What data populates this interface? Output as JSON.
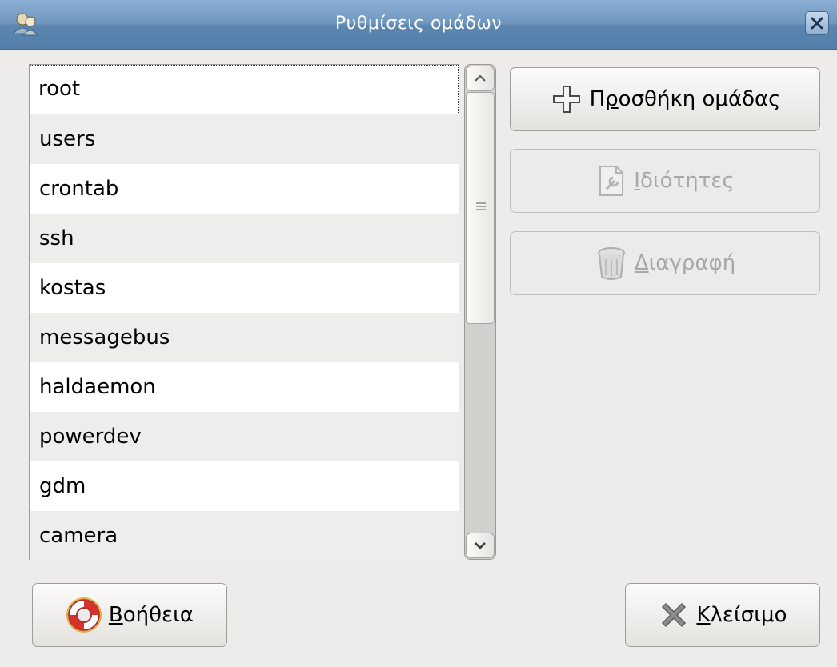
{
  "window": {
    "title": "Ρυθμίσεις ομάδων"
  },
  "groups": [
    "root",
    "users",
    "crontab",
    "ssh",
    "kostas",
    "messagebus",
    "haldaemon",
    "powerdev",
    "gdm",
    "camera"
  ],
  "buttons": {
    "add_group": {
      "mnemonic": "",
      "prefix": "Π",
      "accel": "ρ",
      "rest": "οσθήκη ομάδας",
      "icon": "plus-icon",
      "enabled": true
    },
    "properties": {
      "prefix": "",
      "accel": "Ι",
      "rest": "διότητες",
      "icon": "properties-icon",
      "enabled": false
    },
    "delete": {
      "prefix": "",
      "accel": "Δ",
      "rest": "ιαγραφή",
      "icon": "trash-icon",
      "enabled": false
    },
    "help": {
      "prefix": "",
      "accel": "Β",
      "rest": "οήθεια",
      "icon": "lifebuoy-icon",
      "enabled": true
    },
    "close": {
      "prefix": "",
      "accel": "Κ",
      "rest": "λείσιμο",
      "icon": "close-x-icon",
      "enabled": true
    }
  },
  "colors": {
    "titlebar": "#6f96bd",
    "window_bg": "#edeceb",
    "row_alt": "#ededec"
  }
}
